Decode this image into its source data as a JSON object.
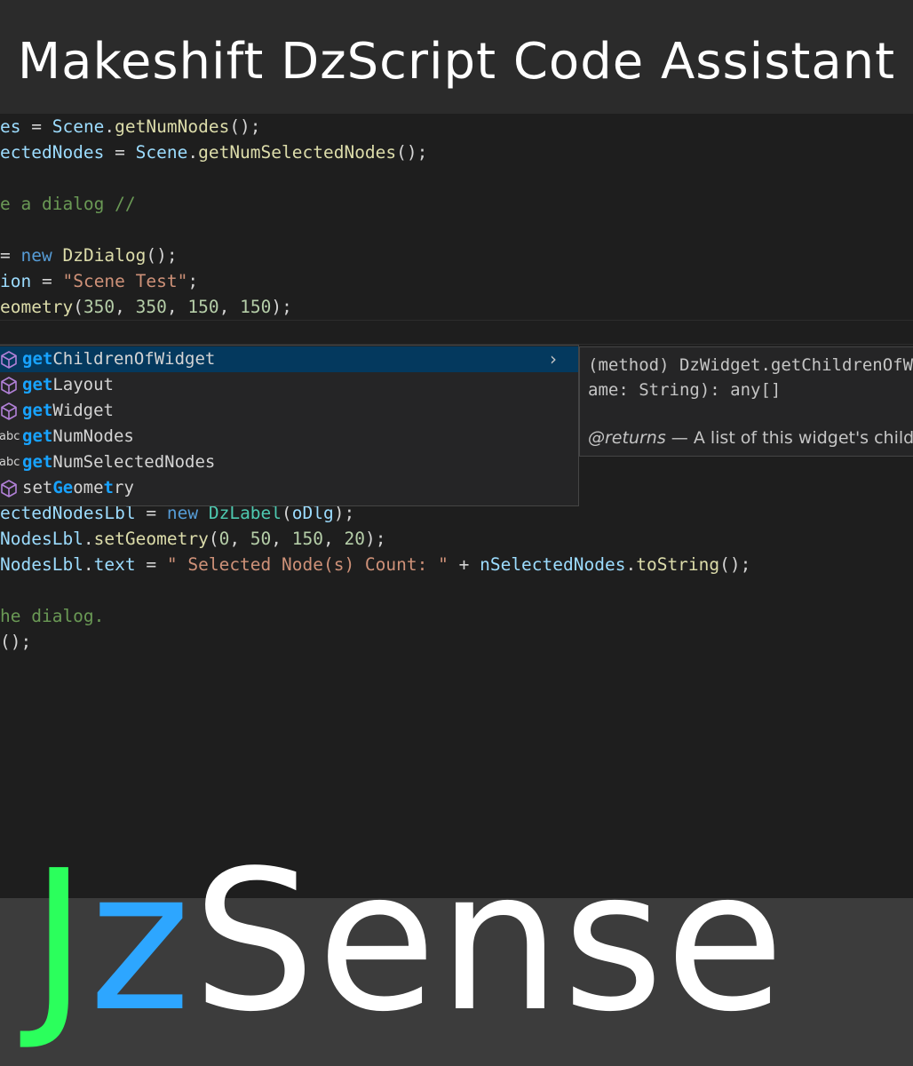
{
  "header": {
    "title": "Makeshift DzScript Code Assistant"
  },
  "colors": {
    "accent_green": "#2bff5c",
    "accent_blue": "#2da6ff",
    "editor_bg": "#1e1e1e",
    "selection_bg": "#04395e"
  },
  "code": {
    "l1": {
      "a": "es",
      "b": " = ",
      "c": "Scene",
      "d": ".",
      "e": "getNumNodes",
      "f": "();"
    },
    "l2": {
      "a": "ectedNodes",
      "b": " = ",
      "c": "Scene",
      "d": ".",
      "e": "getNumSelectedNodes",
      "f": "();"
    },
    "l3": {
      "a": "e a dialog //"
    },
    "l4": {
      "a": "= ",
      "b": "new",
      "c": " ",
      "d": "DzDialog",
      "e": "();"
    },
    "l5": {
      "a": "ion",
      "b": " = ",
      "c": "\"Scene Test\"",
      "d": ";"
    },
    "l6": {
      "a": "eometry",
      "b": "(",
      "c": "350",
      "d": ", ",
      "e": "350",
      "f": ", ",
      "g": "150",
      "h": ", ",
      "i": "150",
      "j": ");"
    },
    "l7": {
      "a": "ectedNodesLbl",
      "b": " = ",
      "c": "new",
      "d": " ",
      "e": "DzLabel",
      "f": "(",
      "g": "oDlg",
      "h": ");"
    },
    "l8": {
      "a": "NodesLbl",
      "b": ".",
      "c": "setGeometry",
      "d": "(",
      "e": "0",
      "f": ", ",
      "g": "50",
      "h": ", ",
      "i": "150",
      "j": ", ",
      "k": "20",
      "l": ");"
    },
    "l9": {
      "a": "NodesLbl",
      "b": ".",
      "c": "text",
      "d": " = ",
      "e": "\" Selected Node(s) Count: \"",
      "f": " + ",
      "g": "nSelectedNodes",
      "h": ".",
      "i": "toString",
      "j": "();"
    },
    "l10": {
      "a": "he dialog."
    },
    "l11": {
      "a": "();"
    }
  },
  "suggestions": [
    {
      "icon": "method-cube-icon",
      "match": "get",
      "rest": "ChildrenOfWidget",
      "selected": true
    },
    {
      "icon": "method-cube-icon",
      "match": "get",
      "rest": "Layout"
    },
    {
      "icon": "method-cube-icon",
      "match": "get",
      "rest": "Widget"
    },
    {
      "icon": "abc-word-icon",
      "abc": "abc",
      "match": "get",
      "rest": "NumNodes"
    },
    {
      "icon": "abc-word-icon",
      "abc": "abc",
      "match": "get",
      "rest": "NumSelectedNodes"
    },
    {
      "icon": "method-cube-icon",
      "parts": [
        "set",
        "Ge",
        "ome",
        "t",
        "ry"
      ]
    }
  ],
  "suggest_chevron": "›",
  "doc": {
    "line1": "(method) DzWidget.getChildrenOfW",
    "line2": "ame: String): any[]",
    "returns_tag": "@returns",
    "returns_text": " — A list of this widget's childr"
  },
  "logo": {
    "j": "J",
    "z": "z",
    "rest": "Sense"
  }
}
